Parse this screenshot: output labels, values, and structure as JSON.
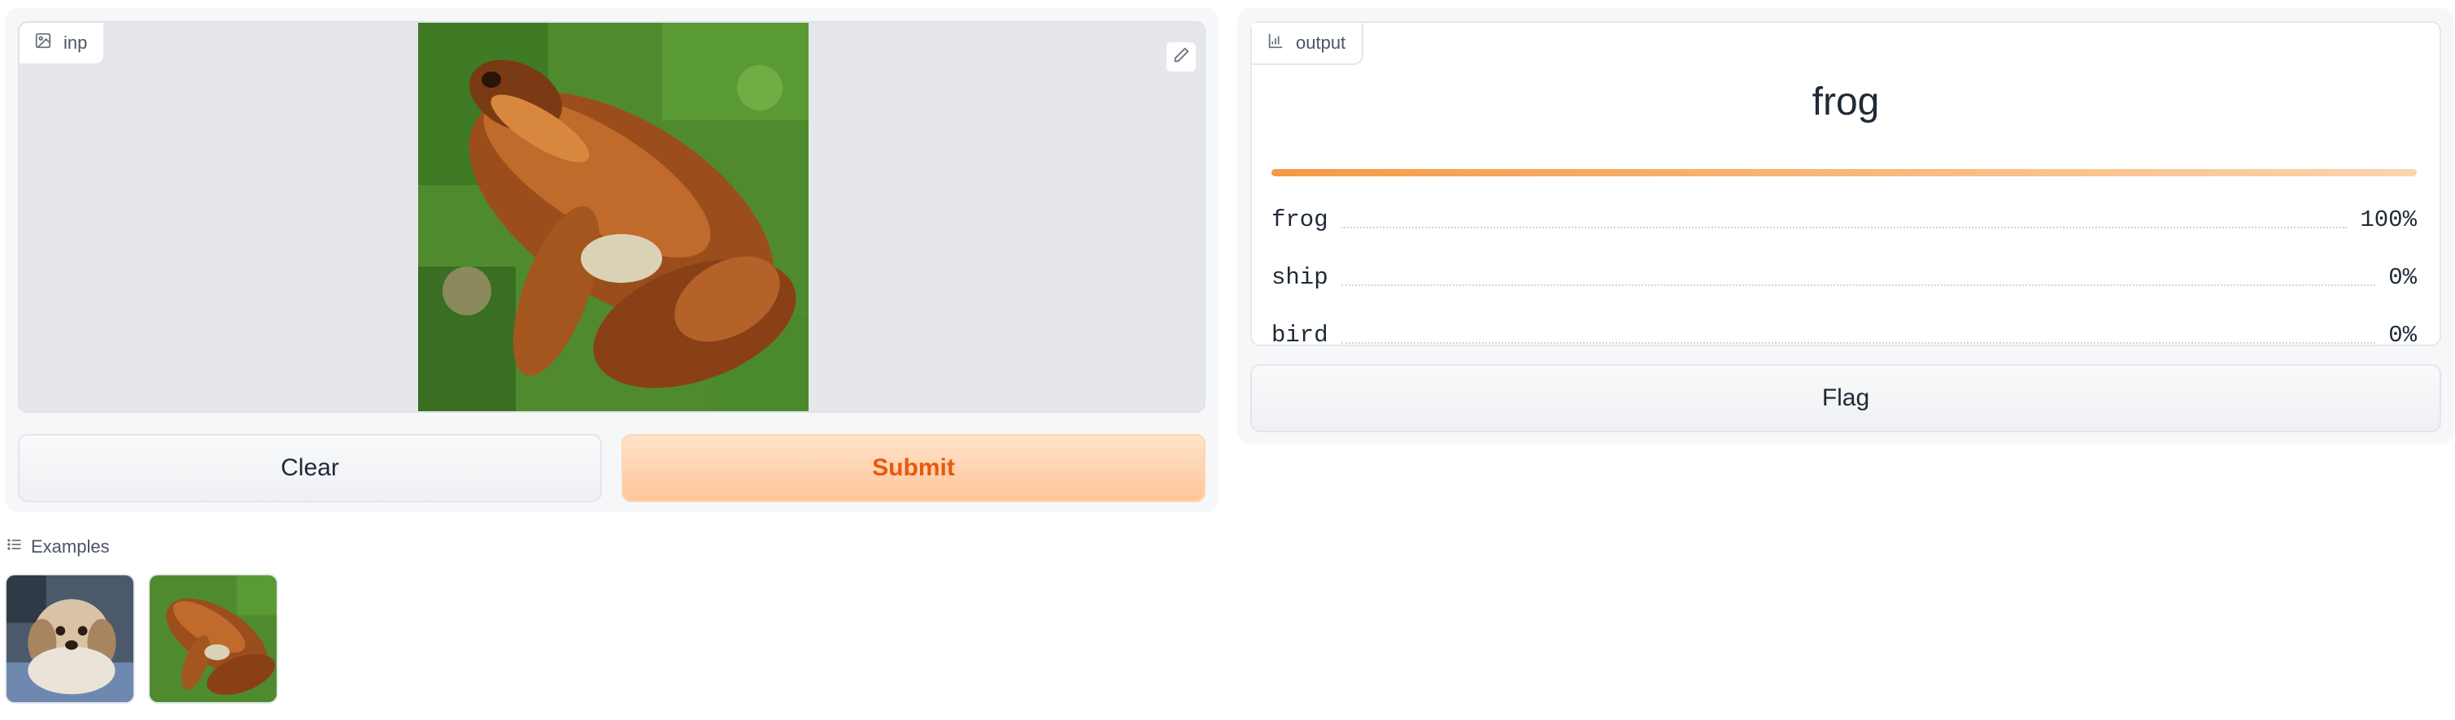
{
  "input": {
    "label": "inp",
    "icons": {
      "label_icon": "image-icon",
      "edit": "pencil-icon",
      "clear": "close-icon"
    }
  },
  "buttons": {
    "clear": "Clear",
    "submit": "Submit",
    "flag": "Flag"
  },
  "output": {
    "label": "output",
    "label_icon": "bar-chart-icon",
    "top_label": "frog",
    "confidences": [
      {
        "label": "frog",
        "value": "100%"
      },
      {
        "label": "ship",
        "value": "0%"
      },
      {
        "label": "bird",
        "value": "0%"
      }
    ]
  },
  "examples": {
    "header": "Examples",
    "icon": "list-icon"
  },
  "colors": {
    "accent": "#f97316",
    "submit_bg": "#ffc59a",
    "panel_bg": "#f6f7f9"
  }
}
